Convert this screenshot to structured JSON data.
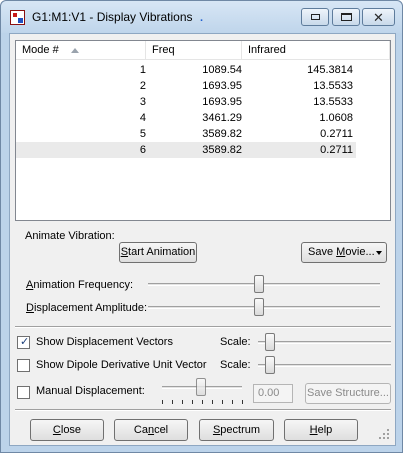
{
  "window": {
    "title": "G1:M1:V1 - Display Vibrations",
    "title_dot": ".",
    "close_glyph": "✕"
  },
  "table": {
    "columns": [
      "Mode #",
      "Freq",
      "Infrared"
    ],
    "rows": [
      {
        "mode": "1",
        "freq": "1089.54",
        "ir": "145.3814"
      },
      {
        "mode": "2",
        "freq": "1693.95",
        "ir": "13.5533"
      },
      {
        "mode": "3",
        "freq": "1693.95",
        "ir": "13.5533"
      },
      {
        "mode": "4",
        "freq": "3461.29",
        "ir": "1.0608"
      },
      {
        "mode": "5",
        "freq": "3589.82",
        "ir": "0.2711"
      },
      {
        "mode": "6",
        "freq": "3589.82",
        "ir": "0.2711"
      }
    ],
    "selected_row": 6
  },
  "animate": {
    "group_label": "Animate Vibration:",
    "start_label_mnemonic": "S",
    "start_label_rest": "tart Animation",
    "save_movie_label_pre": "Save ",
    "save_movie_label_mnemonic": "M",
    "save_movie_label_post": "ovie...",
    "frequency_label_pre": "",
    "frequency_label_mnemonic": "A",
    "frequency_label_post": "nimation Frequency:",
    "frequency_slider_value": 0.5,
    "amplitude_label_pre": "",
    "amplitude_label_mnemonic": "D",
    "amplitude_label_post": "isplacement Amplitude:",
    "amplitude_slider_value": 0.5
  },
  "options": {
    "show_vectors_label": "Show Displacement Vectors",
    "show_vectors_checked": true,
    "show_dipole_label": "Show Dipole Derivative Unit Vector",
    "show_dipole_checked": false,
    "scale_label": "Scale:",
    "manual_label": "Manual Displacement:",
    "manual_checked": false,
    "manual_value": "0.00",
    "save_structure_label": "Save Structure..."
  },
  "footer": {
    "close_mnemonic": "C",
    "close_rest": "lose",
    "cancel_pre": "Ca",
    "cancel_mnemonic": "n",
    "cancel_post": "cel",
    "spectrum_pre": "",
    "spectrum_mnemonic": "S",
    "spectrum_post": "pectrum",
    "help_mnemonic": "H",
    "help_rest": "elp"
  }
}
